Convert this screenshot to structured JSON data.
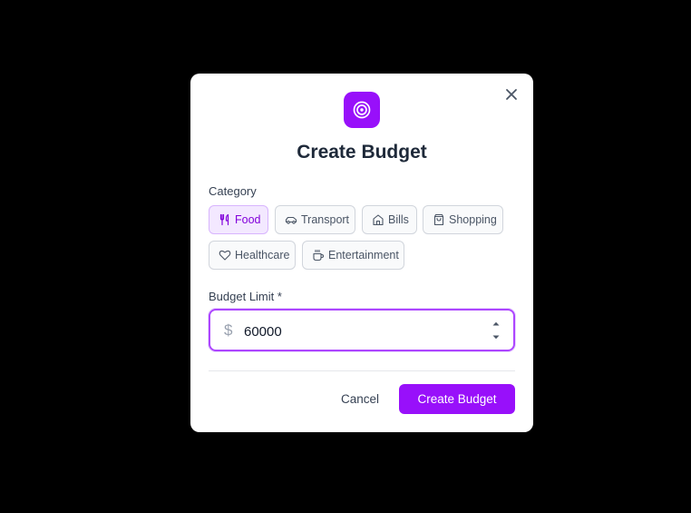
{
  "dialog": {
    "title": "Create Budget",
    "icon": "target-icon",
    "close_icon": "close-icon"
  },
  "category": {
    "label": "Category",
    "selected": "Food",
    "options": [
      {
        "label": "Food",
        "icon": "utensils-icon"
      },
      {
        "label": "Transport",
        "icon": "car-icon"
      },
      {
        "label": "Bills",
        "icon": "home-icon"
      },
      {
        "label": "Shopping",
        "icon": "shopping-bag-icon"
      },
      {
        "label": "Healthcare",
        "icon": "heart-icon"
      },
      {
        "label": "Entertainment",
        "icon": "coffee-icon"
      }
    ]
  },
  "budget_limit": {
    "label": "Budget Limit *",
    "currency_symbol": "$",
    "value": "60000"
  },
  "actions": {
    "cancel_label": "Cancel",
    "submit_label": "Create Budget"
  },
  "colors": {
    "accent": "#9810fa",
    "accent_light": "#f3e8ff",
    "overlay": "#000000"
  }
}
